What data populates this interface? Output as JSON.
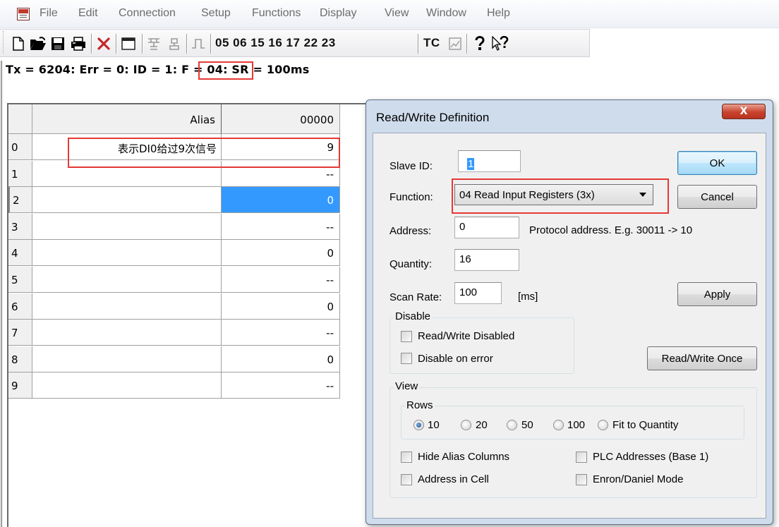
{
  "menu": {
    "items": [
      "File",
      "Edit",
      "Connection",
      "Setup",
      "Functions",
      "Display",
      "View",
      "Window",
      "Help"
    ]
  },
  "toolbar": {
    "function_codes": "05 06 15 16 17 22 23",
    "tc_label": "TC"
  },
  "status": {
    "text": "Tx = 6204: Err = 0: ID = 1: F = 04: SR = 100ms"
  },
  "grid": {
    "headers": {
      "alias": "Alias",
      "column": "00000"
    },
    "rows": [
      {
        "index": "0",
        "alias": "表示DI0给过9次信号",
        "value": "9"
      },
      {
        "index": "1",
        "alias": "",
        "value": "--"
      },
      {
        "index": "2",
        "alias": "",
        "value": "0"
      },
      {
        "index": "3",
        "alias": "",
        "value": "--"
      },
      {
        "index": "4",
        "alias": "",
        "value": "0"
      },
      {
        "index": "5",
        "alias": "",
        "value": "--"
      },
      {
        "index": "6",
        "alias": "",
        "value": "0"
      },
      {
        "index": "7",
        "alias": "",
        "value": "--"
      },
      {
        "index": "8",
        "alias": "",
        "value": "0"
      },
      {
        "index": "9",
        "alias": "",
        "value": "--"
      }
    ],
    "selected_row": 2
  },
  "dialog": {
    "title": "Read/Write Definition",
    "close_label": "X",
    "slave_id": {
      "label": "Slave ID:",
      "value": "1"
    },
    "function": {
      "label": "Function:",
      "value": "04 Read Input Registers (3x)"
    },
    "address": {
      "label": "Address:",
      "value": "0",
      "hint": "Protocol address. E.g. 30011 -> 10"
    },
    "quantity": {
      "label": "Quantity:",
      "value": "16"
    },
    "scan_rate": {
      "label": "Scan Rate:",
      "value": "100",
      "unit": "[ms]"
    },
    "buttons": {
      "ok": "OK",
      "cancel": "Cancel",
      "apply": "Apply",
      "read_write_once": "Read/Write Once"
    },
    "disable_group": {
      "title": "Disable",
      "read_write_disabled": "Read/Write Disabled",
      "disable_on_error": "Disable on error"
    },
    "view_group": {
      "title": "View",
      "rows_title": "Rows",
      "rows_options": [
        "10",
        "20",
        "50",
        "100",
        "Fit to Quantity"
      ],
      "rows_selected": "10",
      "hide_alias_columns": "Hide Alias Columns",
      "address_in_cell": "Address in Cell",
      "plc_addresses": "PLC Addresses (Base 1)",
      "enron_daniel": "Enron/Daniel Mode"
    }
  },
  "colors": {
    "highlight_box": "#e53935",
    "selection": "#3399ff",
    "dialog_frame": "#cfdcec"
  }
}
